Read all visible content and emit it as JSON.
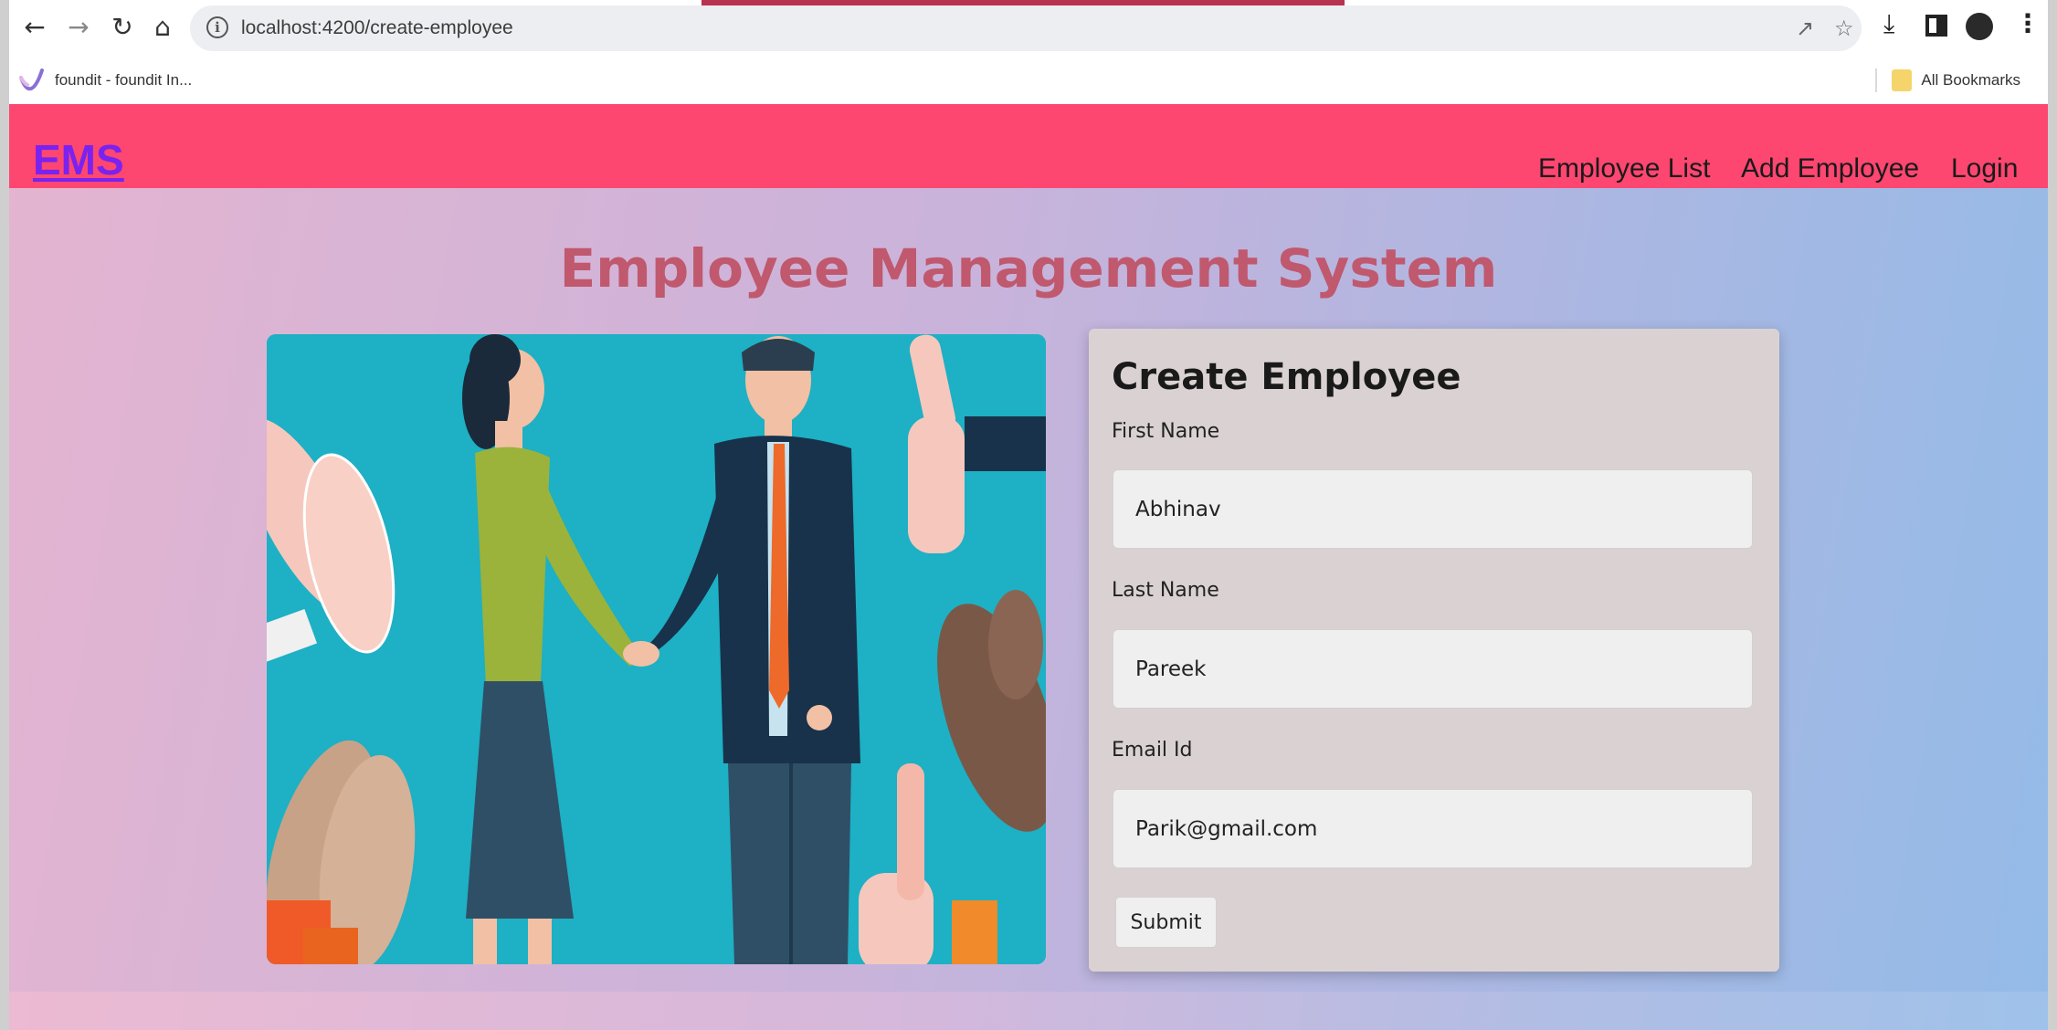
{
  "browser": {
    "url": "localhost:4200/create-employee",
    "bookmark_label": "foundit - foundit In...",
    "all_bookmarks_label": "All Bookmarks",
    "icons": [
      "back-arrow-icon",
      "forward-arrow-icon",
      "reload-icon",
      "home-icon",
      "site-info-icon",
      "share-icon",
      "star-icon",
      "download-icon",
      "side-panel-icon",
      "profile-icon",
      "more-menu-icon"
    ]
  },
  "navbar": {
    "brand": "EMS",
    "links": [
      "Employee List",
      "Add Employee",
      "Login"
    ],
    "background": "#fd4670",
    "brand_color": "#7a22f0"
  },
  "main": {
    "title": "Employee Management System",
    "title_color": "#c0586e"
  },
  "form": {
    "title": "Create Employee",
    "first_name_label": "First Name",
    "first_name_value": "Abhinav",
    "last_name_label": "Last Name",
    "last_name_value": "Pareek",
    "email_label": "Email Id",
    "email_value": "Parik@gmail.com",
    "submit_label": "Submit"
  }
}
